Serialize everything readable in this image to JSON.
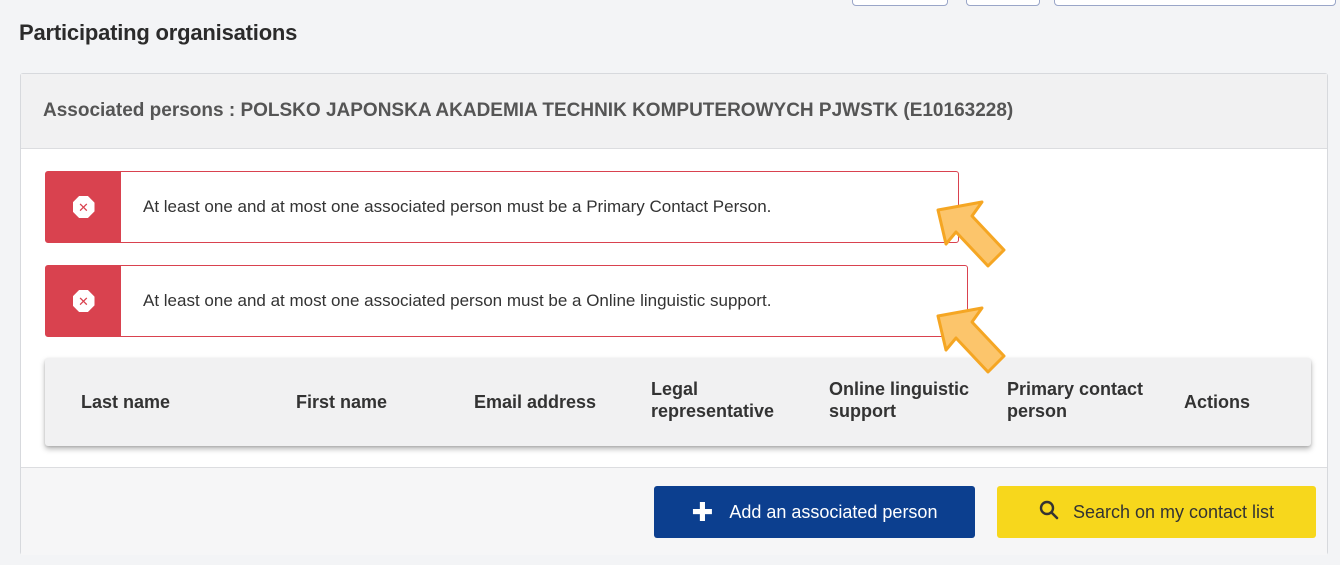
{
  "page": {
    "title": "Participating organisations"
  },
  "panel": {
    "header": "Associated persons : POLSKO JAPONSKA AKADEMIA TECHNIK KOMPUTEROWYCH PJWSTK (E10163228)"
  },
  "alerts": [
    {
      "text": "At least one and at most one associated person must be a Primary Contact Person."
    },
    {
      "text": "At least one and at most one associated person must be a Online linguistic support."
    }
  ],
  "table": {
    "columns": [
      {
        "line1": "Last name",
        "line2": ""
      },
      {
        "line1": "First name",
        "line2": ""
      },
      {
        "line1": "Email address",
        "line2": ""
      },
      {
        "line1": "Legal",
        "line2": "representative"
      },
      {
        "line1": "Online linguistic",
        "line2": "support"
      },
      {
        "line1": "Primary contact",
        "line2": "person"
      },
      {
        "line1": "Actions",
        "line2": ""
      }
    ]
  },
  "footer": {
    "add_label": "Add an associated person",
    "search_label": "Search on my contact list"
  },
  "colors": {
    "error": "#d9424f",
    "primary_button": "#0c3f8f",
    "secondary_button": "#f7d71c",
    "annotation_arrow": "#f5a623"
  },
  "icons": {
    "alert": "error-octagon-icon",
    "add": "plus-icon",
    "search": "search-icon",
    "annotation": "pointer-arrow-icon"
  }
}
